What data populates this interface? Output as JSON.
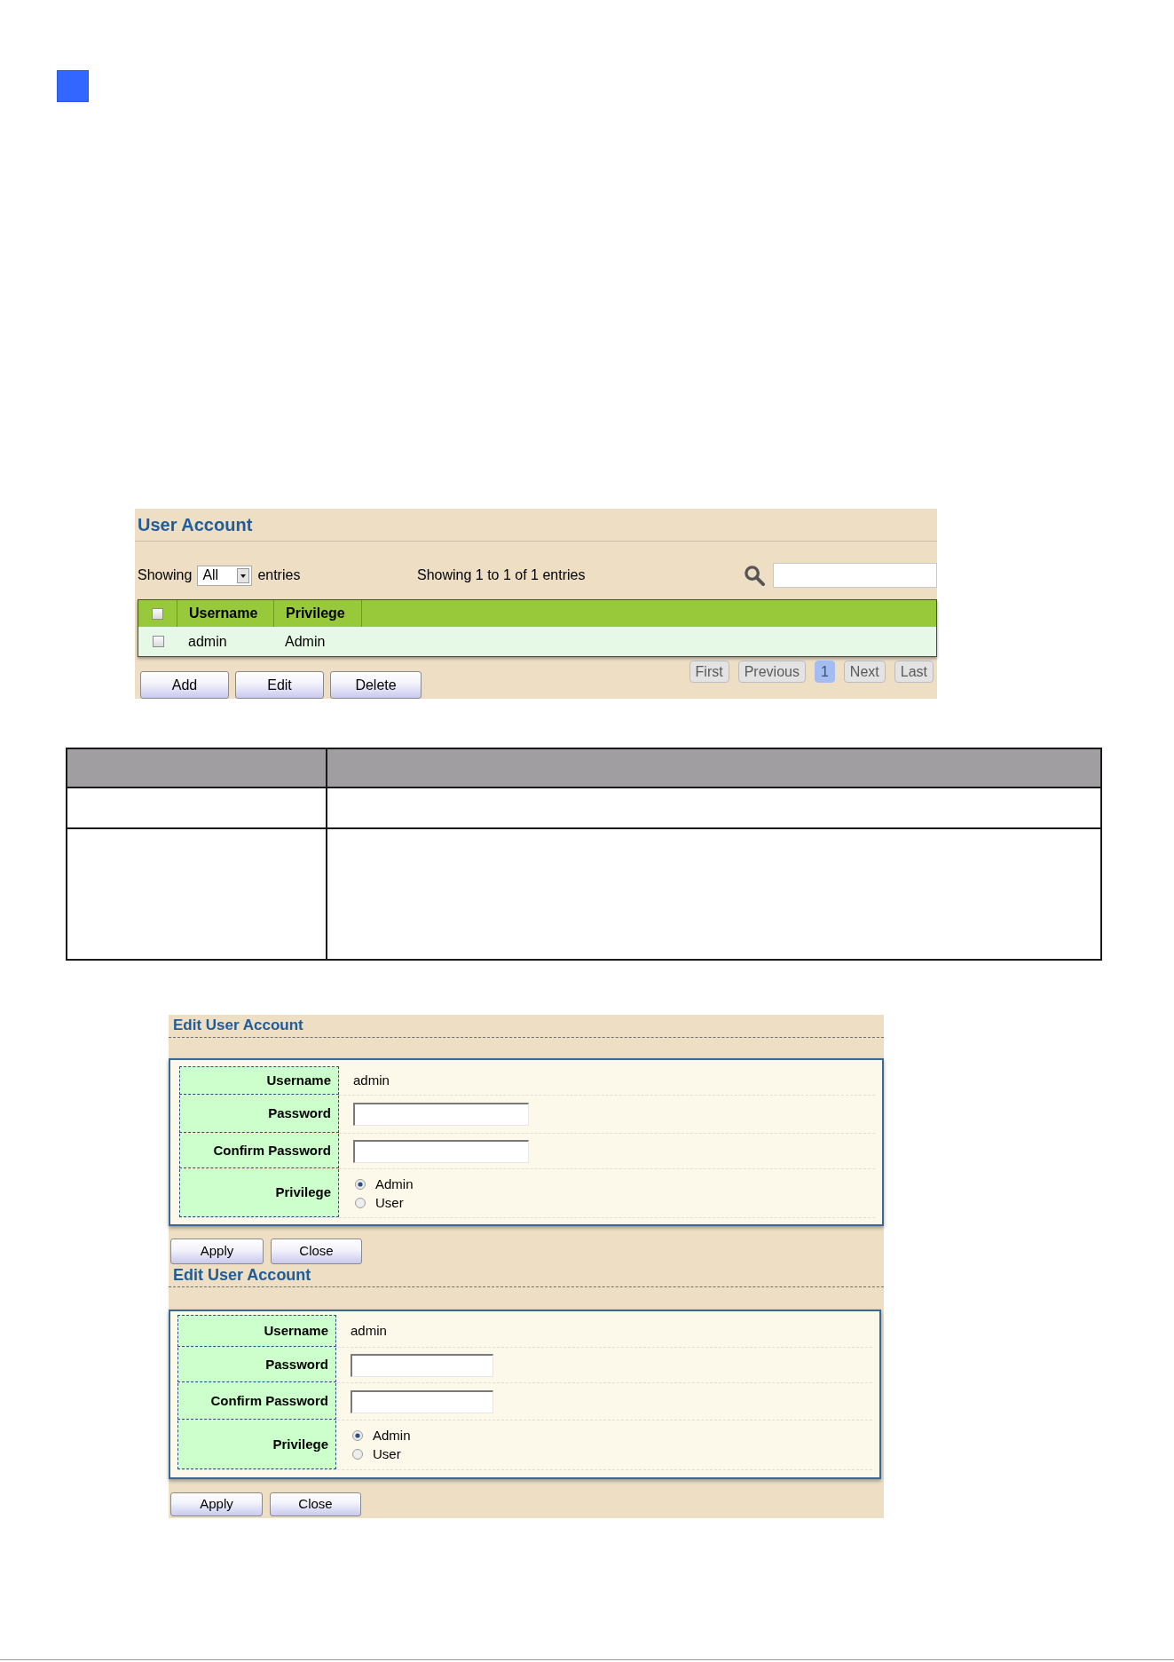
{
  "user_account": {
    "title": "User Account",
    "length_label": "Showing",
    "length_select": "All",
    "length_suffix": "entries",
    "info": "Showing 1 to 1 of 1 entries",
    "table": {
      "select_all": {
        "checked": false
      },
      "columns": [
        "Username",
        "Privilege"
      ],
      "rows": [
        {
          "checked": false,
          "cells": [
            "admin",
            "Admin"
          ]
        }
      ]
    },
    "buttons": [
      "Add",
      "Edit",
      "Delete"
    ],
    "pagination": [
      {
        "label": "First",
        "selected": false
      },
      {
        "label": "Previous",
        "selected": false
      },
      {
        "label": "1",
        "selected": true
      },
      {
        "label": "Next",
        "selected": false
      },
      {
        "label": "Last",
        "selected": false
      }
    ]
  },
  "edit_forms": [
    {
      "title": "Edit User Account",
      "fields": [
        {
          "kind": "text",
          "label": "Username",
          "value": "admin"
        },
        {
          "kind": "input",
          "label": "Password"
        },
        {
          "kind": "input",
          "label": "Confirm Password"
        },
        {
          "kind": "radio",
          "label": "Privilege",
          "options": [
            {
              "label": "Admin",
              "selected": true
            },
            {
              "label": "User",
              "selected": false
            }
          ]
        }
      ],
      "buttons": [
        "Apply",
        "Close"
      ]
    },
    {
      "title": "Edit User Account",
      "fields": [
        {
          "kind": "text",
          "label": "Username",
          "value": "admin"
        },
        {
          "kind": "input",
          "label": "Password"
        },
        {
          "kind": "input",
          "label": "Confirm Password"
        },
        {
          "kind": "radio",
          "label": "Privilege",
          "options": [
            {
              "label": "Admin",
              "selected": true
            },
            {
              "label": "User",
              "selected": false
            }
          ]
        }
      ],
      "buttons": [
        "Apply",
        "Close"
      ]
    }
  ]
}
